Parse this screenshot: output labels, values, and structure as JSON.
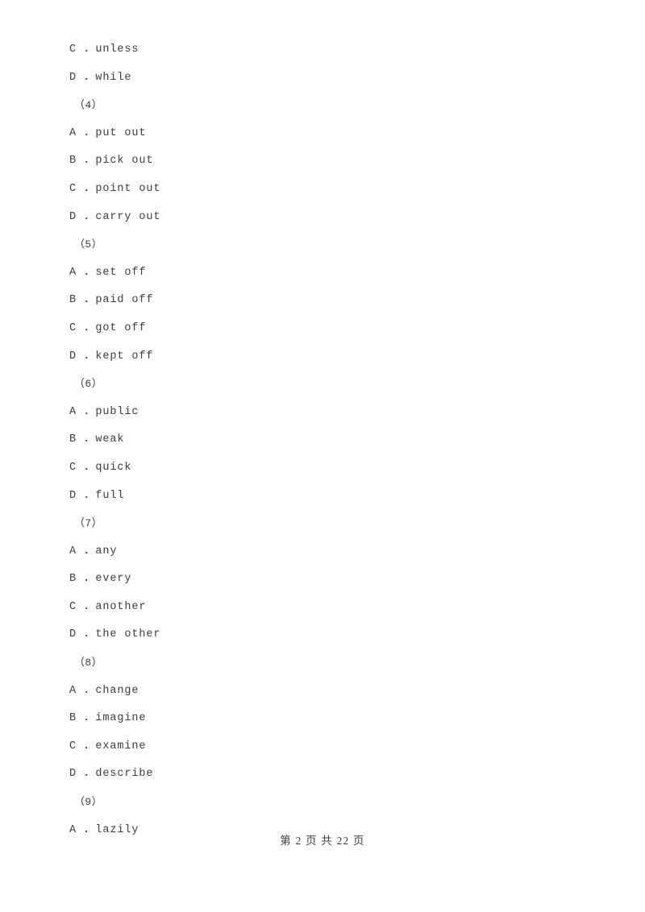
{
  "document": {
    "type": "exam-worksheet",
    "language": "zh-CN",
    "background_color": "#ffffff",
    "text_color": "#3d3d3d"
  },
  "lines": [
    {
      "kind": "option",
      "text": "C ．unless"
    },
    {
      "kind": "option",
      "text": "D ．while"
    },
    {
      "kind": "qnum",
      "text": "（4）"
    },
    {
      "kind": "option",
      "text": "A ．put out"
    },
    {
      "kind": "option",
      "text": "B ．pick out"
    },
    {
      "kind": "option",
      "text": "C ．point out"
    },
    {
      "kind": "option",
      "text": "D ．carry out"
    },
    {
      "kind": "qnum",
      "text": "（5）"
    },
    {
      "kind": "option",
      "text": "A ．set off"
    },
    {
      "kind": "option",
      "text": "B ．paid off"
    },
    {
      "kind": "option",
      "text": "C ．got off"
    },
    {
      "kind": "option",
      "text": "D ．kept off"
    },
    {
      "kind": "qnum",
      "text": "（6）"
    },
    {
      "kind": "option",
      "text": "A ．public"
    },
    {
      "kind": "option",
      "text": "B ．weak"
    },
    {
      "kind": "option",
      "text": "C ．quick"
    },
    {
      "kind": "option",
      "text": "D ．full"
    },
    {
      "kind": "qnum",
      "text": "（7）"
    },
    {
      "kind": "option",
      "text": "A ．any"
    },
    {
      "kind": "option",
      "text": "B ．every"
    },
    {
      "kind": "option",
      "text": "C ．another"
    },
    {
      "kind": "option",
      "text": "D ．the other"
    },
    {
      "kind": "qnum",
      "text": "（8）"
    },
    {
      "kind": "option",
      "text": "A ．change"
    },
    {
      "kind": "option",
      "text": "B ．imagine"
    },
    {
      "kind": "option",
      "text": "C ．examine"
    },
    {
      "kind": "option",
      "text": "D ．describe"
    },
    {
      "kind": "qnum",
      "text": "（9）"
    },
    {
      "kind": "option",
      "text": "A ．lazily"
    }
  ],
  "footer": {
    "text": "第 2 页 共 22 页",
    "current_page": "2",
    "total_pages": "22"
  }
}
